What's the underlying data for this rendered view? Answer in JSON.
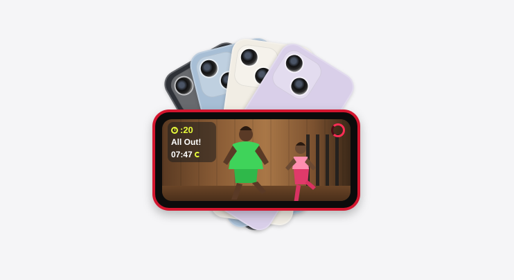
{
  "scene": {
    "background_color": "#f5f5f7",
    "phone_colors": {
      "midnight": "#2e3137",
      "blue": "#a7bed5",
      "starlight": "#f1ede4",
      "purple": "#d9cfe9",
      "red": "#d3162f"
    }
  },
  "workout_overlay": {
    "timer": ":20",
    "message": "All Out!",
    "clock": "07:47",
    "timer_icon": "stopwatch-icon",
    "ring_icon": "activity-ring-icon",
    "accent_color": "#e6f93a"
  }
}
